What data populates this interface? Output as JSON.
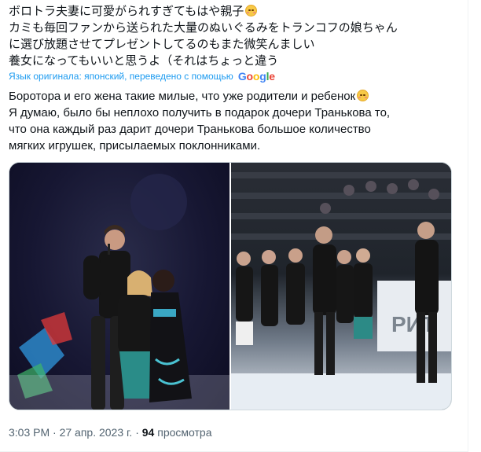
{
  "tweet": {
    "original_lines": [
      "ボロトラ夫妻に可愛がられすぎてもはや親子",
      "カミも毎回ファンから送られた大量のぬいぐるみをトランコフの娘ちゃん",
      "に選び放題させてプレゼントしてるのもまた微笑んましい",
      "養女になってもいいと思うよ（それはちょっと違う"
    ],
    "translation_note": "Язык оригинала: японский, переведено с помощью",
    "translator_brand": "Google",
    "translated_lines": [
      "Боротора и его жена такие милые, что уже родители и ребенок",
      "Я думаю, было бы неплохо получить в подарок дочери Транькова то,",
      "что она каждый раз дарит дочери Транькова большое количество",
      "мягких игрушек, присылаемых поклонниками."
    ],
    "emoji": "smiling-face-with-hearts",
    "time": "3:03 PM",
    "date": "27 апр. 2023 г.",
    "views_count": "94",
    "views_label": "просмотра",
    "separator": "·"
  },
  "colors": {
    "link": "#1d9bf0",
    "text": "#0f1419",
    "muted": "#536471",
    "border": "#cfd9de"
  }
}
